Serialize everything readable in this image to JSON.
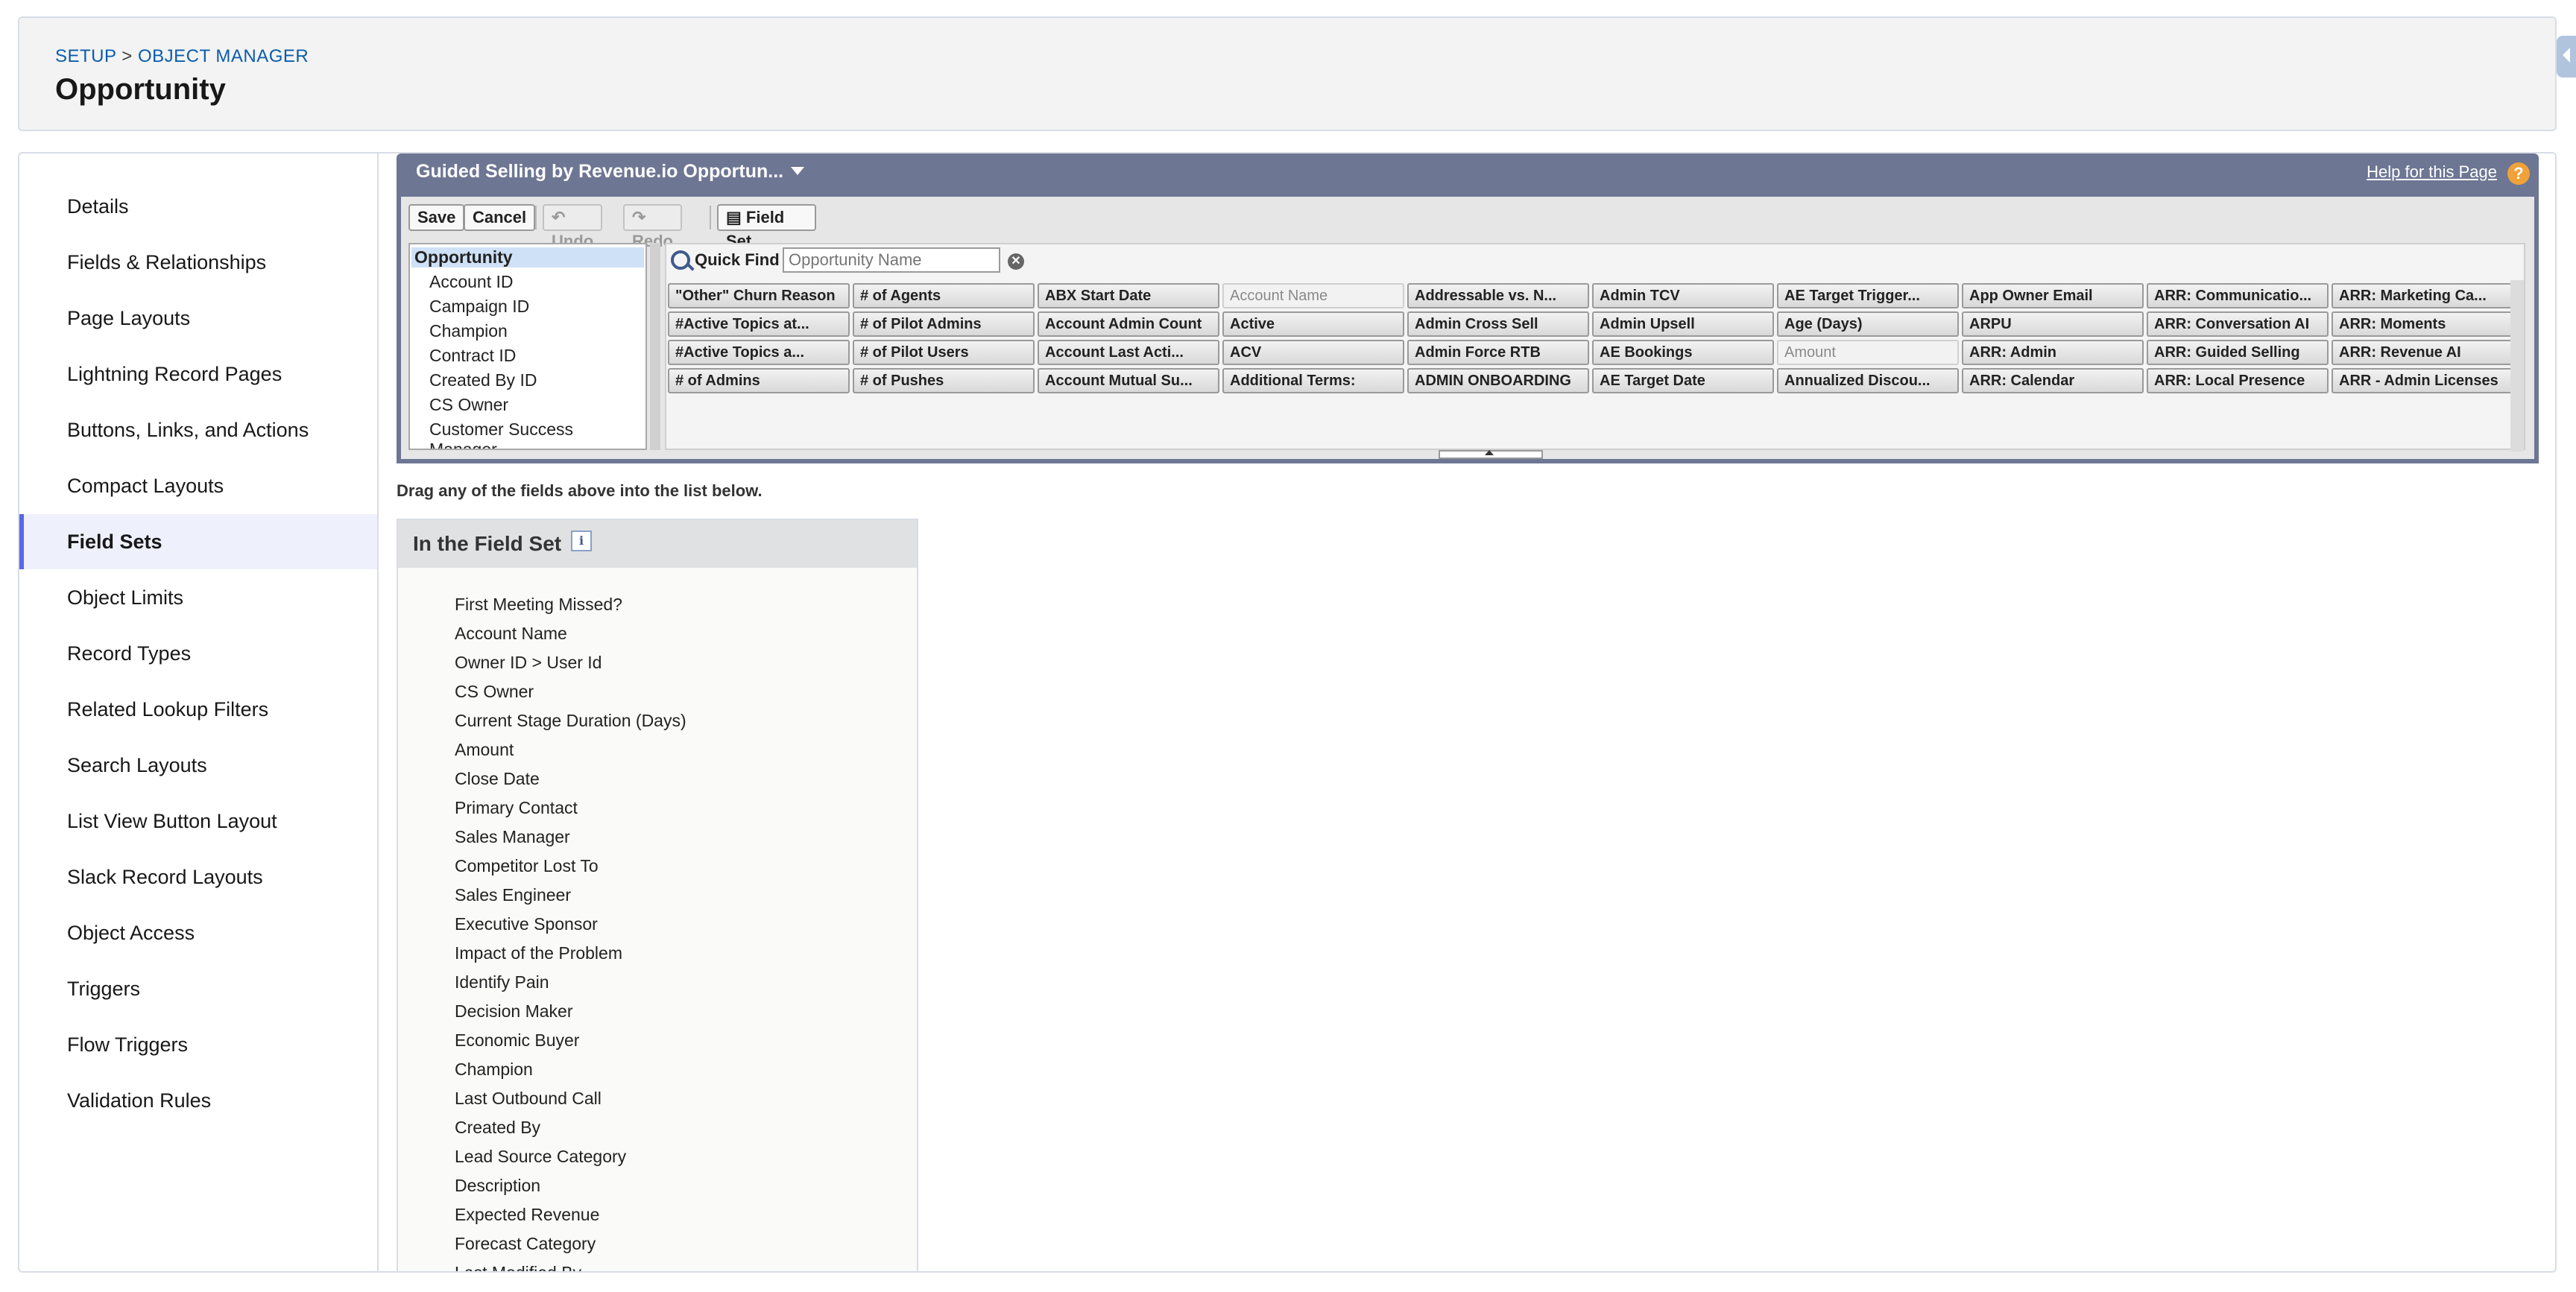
{
  "header": {
    "breadcrumb_setup": "SETUP",
    "breadcrumb_sep": " > ",
    "breadcrumb_object_manager": "OBJECT MANAGER",
    "title": "Opportunity"
  },
  "sidebar": {
    "items": [
      {
        "label": "Details"
      },
      {
        "label": "Fields & Relationships"
      },
      {
        "label": "Page Layouts"
      },
      {
        "label": "Lightning Record Pages"
      },
      {
        "label": "Buttons, Links, and Actions"
      },
      {
        "label": "Compact Layouts"
      },
      {
        "label": "Field Sets",
        "active": true
      },
      {
        "label": "Object Limits"
      },
      {
        "label": "Record Types"
      },
      {
        "label": "Related Lookup Filters"
      },
      {
        "label": "Search Layouts"
      },
      {
        "label": "List View Button Layout"
      },
      {
        "label": "Slack Record Layouts"
      },
      {
        "label": "Object Access"
      },
      {
        "label": "Triggers"
      },
      {
        "label": "Flow Triggers"
      },
      {
        "label": "Validation Rules"
      }
    ]
  },
  "palette": {
    "title": "Guided Selling by Revenue.io Opportun...",
    "help_link": "Help for this Page",
    "help_icon": "?",
    "toolbar": {
      "save": "Save",
      "cancel": "Cancel",
      "undo": "Undo",
      "redo": "Redo",
      "field_set_properties": "Field Set Properties"
    },
    "object_list": [
      "Opportunity",
      "Account ID",
      "Campaign ID",
      "Champion",
      "Contract ID",
      "Created By ID",
      "CS Owner",
      "Customer Success Manager"
    ],
    "quick_find_label": "Quick Find",
    "quick_find_placeholder": "Opportunity Name",
    "fields": [
      [
        "\"Other\" Churn Reason",
        "#Active Topics at...",
        "#Active Topics a...",
        "# of Admins"
      ],
      [
        "# of Agents",
        "# of Pilot Admins",
        "# of Pilot Users",
        "# of Pushes"
      ],
      [
        "ABX Start Date",
        "Account Admin Count",
        "Account Last Acti...",
        "Account Mutual Su..."
      ],
      [
        "Account Name",
        "Active",
        "ACV",
        "Additional Terms:"
      ],
      [
        "Addressable vs. N...",
        "Admin Cross Sell",
        "Admin Force RTB",
        "ADMIN ONBOARDING"
      ],
      [
        "Admin TCV",
        "Admin Upsell",
        "AE Bookings",
        "AE Target Date"
      ],
      [
        "AE Target Trigger...",
        "Age (Days)",
        "Amount",
        "Annualized Discou..."
      ],
      [
        "App Owner Email",
        "ARPU",
        "ARR: Admin",
        "ARR: Calendar"
      ],
      [
        "ARR: Communicatio...",
        "ARR: Conversation AI",
        "ARR: Guided Selling",
        "ARR: Local Presence"
      ],
      [
        "ARR: Marketing Ca...",
        "ARR: Moments",
        "ARR: Revenue AI",
        "ARR - Admin Licenses"
      ]
    ],
    "used_fields": [
      "Account Name",
      "Amount"
    ]
  },
  "drag_hint": "Drag any of the fields above into the list below.",
  "field_set": {
    "title": "In the Field Set",
    "info_icon": "i",
    "items": [
      "First Meeting Missed?",
      "Account Name",
      "Owner ID > User Id",
      "CS Owner",
      "Current Stage Duration (Days)",
      "Amount",
      "Close Date",
      "Primary Contact",
      "Sales Manager",
      "Competitor Lost To",
      "Sales Engineer",
      "Executive Sponsor",
      "Impact of the Problem",
      "Identify Pain",
      "Decision Maker",
      "Economic Buyer",
      "Champion",
      "Last Outbound Call",
      "Created By",
      "Lead Source Category",
      "Description",
      "Expected Revenue",
      "Forecast Category",
      "Last Modified By"
    ]
  },
  "colors": {
    "accent": "#5867e8",
    "link": "#0b5cab",
    "palette_header": "#6d7693"
  }
}
